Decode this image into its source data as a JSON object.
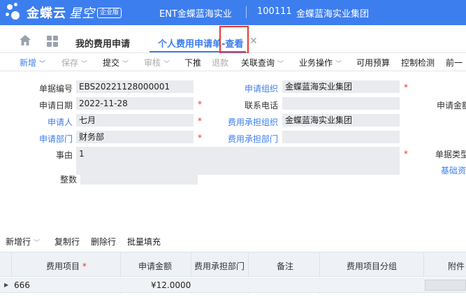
{
  "header": {
    "logo_text": "金蝶云",
    "logo_star": "星空",
    "logo_badge": "企业版",
    "org": "ENT金蝶蓝海实业",
    "code": "100111",
    "group": "金蝶蓝海实业集团"
  },
  "tabs": [
    {
      "label": "我的费用申请"
    },
    {
      "label": "个人费用申请单-查看"
    }
  ],
  "toolbar": {
    "add": "新增",
    "save": "保存",
    "submit": "提交",
    "audit": "审核",
    "push": "下推",
    "return": "退款",
    "query": "关联查询",
    "ops": "业务操作",
    "budget": "可用预算",
    "control": "控制检测",
    "prev": "前一"
  },
  "form": {
    "bill_no_label": "单据编号",
    "bill_no": "EBS20221128000001",
    "apply_date_label": "申请日期",
    "apply_date": "2022-11-28",
    "applicant_label": "申请人",
    "applicant": "七月",
    "dept_label": "申请部门",
    "dept": "财务部",
    "reason_label": "事由",
    "reason": "1",
    "round_label": "整数",
    "org_label": "申请组织",
    "org": "金蝶蓝海实业集团",
    "phone_label": "联系电话",
    "cost_org_label": "费用承担组织",
    "cost_org": "金蝶蓝海实业集团",
    "cost_dept_label": "费用承担部门",
    "amount_label": "申请金额",
    "bill_type_label": "单据类型",
    "basic_label": "基础资"
  },
  "grid": {
    "tools": {
      "add_row": "新增行",
      "copy_row": "复制行",
      "delete_row": "删除行",
      "batch_fill": "批量填充"
    },
    "columns": [
      "费用项目",
      "申请金额",
      "费用承担部门",
      "备注",
      "费用项目分组",
      "附件"
    ],
    "rows": [
      {
        "item": "666",
        "amount": "¥12.0000",
        "dept": "",
        "remark": "",
        "group": "",
        "attach": ""
      }
    ]
  }
}
